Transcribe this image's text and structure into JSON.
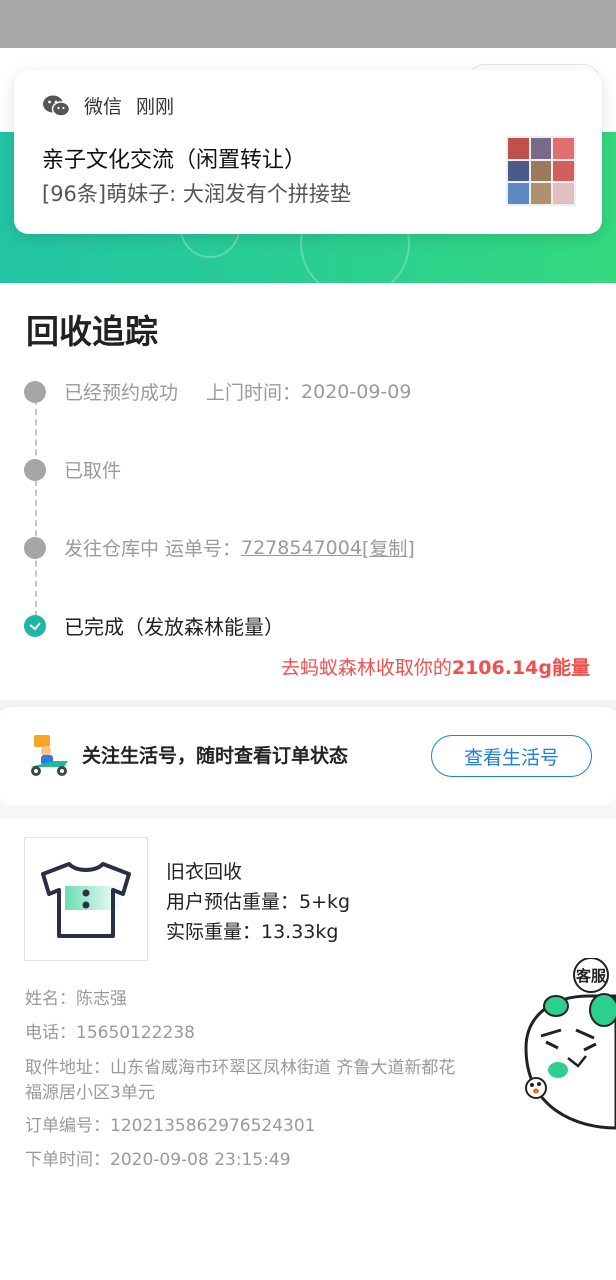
{
  "notification": {
    "app_name": "微信",
    "time": "刚刚",
    "title": "亲子文化交流（闲置转让）",
    "message": "[96条]萌妹子: 大润发有个拼接垫"
  },
  "tracking": {
    "heading": "回收追踪",
    "steps": [
      {
        "label": "已经预约成功",
        "extra_label": "上门时间：",
        "extra_value": "2020-09-09"
      },
      {
        "label": "已取件"
      },
      {
        "label": "发往仓库中 运单号：",
        "tracking_number": "7278547004",
        "copy_label": "[复制]"
      },
      {
        "label": "已完成（发放森林能量）"
      }
    ],
    "energy_prefix": "去蚂蚁森林收取你的",
    "energy_value": "2106.14g",
    "energy_suffix": "能量"
  },
  "follow": {
    "text": "关注生活号，随时查看订单状态",
    "button_label": "查看生活号"
  },
  "order": {
    "product_name": "旧衣回收",
    "estimated_weight": "用户预估重量：5+kg",
    "actual_weight": "实际重量：13.33kg",
    "name": "姓名：陈志强",
    "phone": "电话：15650122238",
    "address_line1": "取件地址：山东省威海市环翠区凤林街道 齐鲁大道新都花",
    "address_line2": "福源居小区3单元",
    "order_number": "订单编号：1202135862976524301",
    "order_time": "下单时间：2020-09-08 23:15:49"
  },
  "customer_service": {
    "label": "客服"
  },
  "colors": {
    "accent_green": "#2bd08f",
    "teal": "#1fb79f",
    "link_blue": "#1e7ee8",
    "energy_red": "#f0504f"
  }
}
